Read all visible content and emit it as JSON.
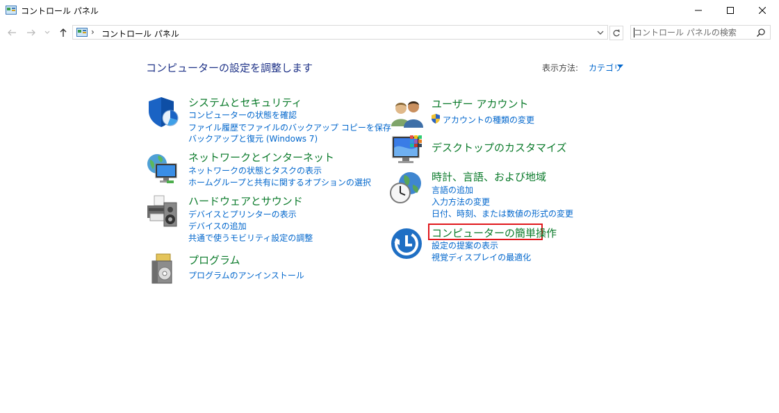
{
  "window": {
    "title": "コントロール パネル"
  },
  "nav": {
    "address": "コントロール パネル",
    "sep1": "›",
    "sep2": "›",
    "search_placeholder": "コントロール パネルの検索"
  },
  "main": {
    "title": "コンピューターの設定を調整します",
    "view_by_label": "表示方法:",
    "view_by_value": "カテゴリ"
  },
  "left_categories": [
    {
      "title": "システムとセキュリティ",
      "links": [
        "コンピューターの状態を確認",
        "ファイル履歴でファイルのバックアップ コピーを保存",
        "バックアップと復元 (Windows 7)"
      ]
    },
    {
      "title": "ネットワークとインターネット",
      "links": [
        "ネットワークの状態とタスクの表示",
        "ホームグループと共有に関するオプションの選択"
      ]
    },
    {
      "title": "ハードウェアとサウンド",
      "links": [
        "デバイスとプリンターの表示",
        "デバイスの追加",
        "共通で使うモビリティ設定の調整"
      ]
    },
    {
      "title": "プログラム",
      "links": [
        "プログラムのアンインストール"
      ]
    }
  ],
  "right_categories": [
    {
      "title": "ユーザー アカウント",
      "links": [
        "アカウントの種類の変更"
      ]
    },
    {
      "title": "デスクトップのカスタマイズ",
      "links": []
    },
    {
      "title": "時計、言語、および地域",
      "links": [
        "言語の追加",
        "入力方法の変更",
        "日付、時刻、または数値の形式の変更"
      ]
    },
    {
      "title": "コンピューターの簡単操作",
      "links": [
        "設定の提案の表示",
        "視覚ディスプレイの最適化"
      ]
    }
  ],
  "colors": {
    "category_title": "#0a7a2a",
    "link": "#0066cc",
    "page_title": "#1e3287",
    "highlight": "#e0161b"
  }
}
